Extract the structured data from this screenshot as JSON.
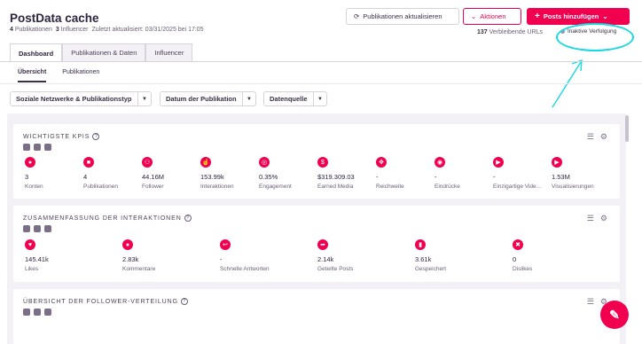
{
  "header": {
    "title": "PostData cache",
    "publications_count": "4",
    "publications_label": "Publikationen",
    "influencer_count": "3",
    "influencer_label": "Influencer",
    "last_updated": "Zuletzt aktualisiert: 03/31/2025 bei 17:05",
    "update_button": "Publikationen aktualisieren",
    "actions_button": "Aktionen",
    "add_button": "Posts hinzufügen",
    "urls_count": "137",
    "urls_label": "Verbleibende URLs",
    "inactive_label": "Inaktive Verfolgung"
  },
  "tabs": [
    "Dashboard",
    "Publikationen & Daten",
    "Influencer"
  ],
  "subtabs": [
    "Übersicht",
    "Publikationen"
  ],
  "filters": [
    "Soziale Netzwerke & Publikationstyp",
    "Datum der Publikation",
    "Datenquelle"
  ],
  "cards": {
    "kpis": {
      "title": "WICHTIGSTE KPIS",
      "metrics": [
        {
          "value": "3",
          "label": "Konten",
          "icon": "user-icon"
        },
        {
          "value": "4",
          "label": "Publikationen",
          "icon": "document-icon"
        },
        {
          "value": "44.16M",
          "label": "Follower",
          "icon": "group-icon"
        },
        {
          "value": "153.99k",
          "label": "Interaktionen",
          "icon": "hand-icon"
        },
        {
          "value": "0.35%",
          "label": "Engagement",
          "icon": "target-icon"
        },
        {
          "value": "$319.309.03",
          "label": "Earned Media",
          "icon": "dollar-icon"
        },
        {
          "value": "-",
          "label": "Reichweite",
          "icon": "reach-icon"
        },
        {
          "value": "-",
          "label": "Eindrücke",
          "icon": "eye-icon"
        },
        {
          "value": "-",
          "label": "Einzigartige Videoaufrufe",
          "icon": "play-icon"
        },
        {
          "value": "1.53M",
          "label": "Visualisierungen",
          "icon": "play-icon"
        }
      ]
    },
    "interactions": {
      "title": "ZUSAMMENFASSUNG DER INTERAKTIONEN",
      "metrics": [
        {
          "value": "145.41k",
          "label": "Likes",
          "icon": "heart-icon"
        },
        {
          "value": "2.83k",
          "label": "Kommentare",
          "icon": "comment-icon"
        },
        {
          "value": "-",
          "label": "Schnelle Antworten",
          "icon": "reply-icon"
        },
        {
          "value": "2.14k",
          "label": "Geteilte Posts",
          "icon": "share-icon"
        },
        {
          "value": "3.61k",
          "label": "Gespeichert",
          "icon": "bookmark-icon"
        },
        {
          "value": "0",
          "label": "Dislikes",
          "icon": "dislike-icon"
        }
      ]
    },
    "followers": {
      "title": "ÜBERSICHT DER FOLLOWER-VERTEILUNG"
    }
  },
  "colors": {
    "accent": "#f0004f",
    "annotation": "#19d8e0"
  }
}
